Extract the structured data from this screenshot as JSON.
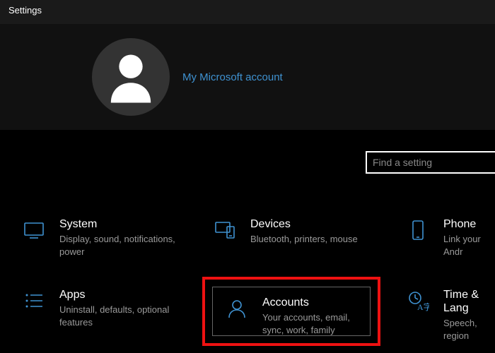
{
  "window_title": "Settings",
  "account": {
    "link_label": "My Microsoft account"
  },
  "search": {
    "placeholder": "Find a setting"
  },
  "tiles": {
    "system": {
      "title": "System",
      "desc": "Display, sound, notifications, power"
    },
    "devices": {
      "title": "Devices",
      "desc": "Bluetooth, printers, mouse"
    },
    "phone": {
      "title": "Phone",
      "desc": "Link your Andr"
    },
    "apps": {
      "title": "Apps",
      "desc": "Uninstall, defaults, optional features"
    },
    "accounts": {
      "title": "Accounts",
      "desc": "Your accounts, email, sync, work, family"
    },
    "time": {
      "title": "Time & Lang",
      "desc": "Speech, region"
    }
  }
}
